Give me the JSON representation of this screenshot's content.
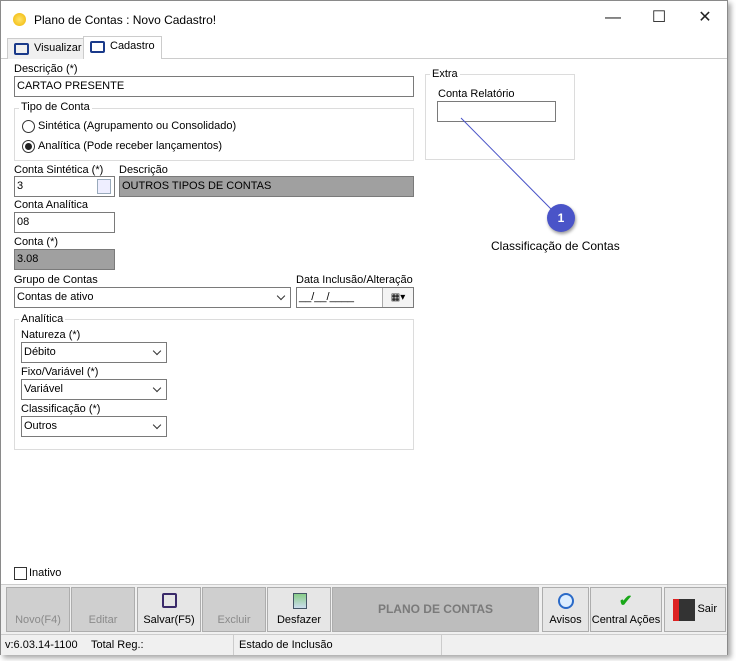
{
  "window": {
    "title": "Plano de Contas  : Novo Cadastro!",
    "minimize": "—",
    "maximize": "☐",
    "close": "✕"
  },
  "tabs": [
    {
      "label": "Visualizar"
    },
    {
      "label": "Cadastro"
    }
  ],
  "form": {
    "descricao_label": "Descrição (*)",
    "descricao_value": "CARTAO PRESENTE",
    "tipo_conta": {
      "label": "Tipo de Conta",
      "options": [
        "Sintética (Agrupamento ou Consolidado)",
        "Analítica (Pode receber lançamentos)"
      ],
      "selected": 1
    },
    "conta_sintetica_label": "Conta Sintética (*)",
    "conta_sintetica_value": "3",
    "descricao2_label": "Descrição",
    "descricao2_value": "OUTROS TIPOS DE CONTAS",
    "conta_analitica_label": "Conta Analítica",
    "conta_analitica_value": "08",
    "conta_label": "Conta (*)",
    "conta_value": "3.08",
    "grupo_label": "Grupo de Contas",
    "grupo_value": "Contas de ativo",
    "data_label": "Data Inclusão/Alteração",
    "data_value": "__/__/____",
    "analitica": {
      "label": "Analítica",
      "natureza_label": "Natureza (*)",
      "natureza_value": "Débito",
      "fixo_label": "Fixo/Variável (*)",
      "fixo_value": "Variável",
      "classificacao_label": "Classificação (*)",
      "classificacao_value": "Outros"
    },
    "extra": {
      "label": "Extra",
      "conta_relatorio_label": "Conta Relatório",
      "conta_relatorio_value": ""
    },
    "inativo_label": "Inativo"
  },
  "callout": {
    "number": "1",
    "text": "Classificação de Contas",
    "color": "#4a54c8"
  },
  "toolbar": {
    "novo": "Novo(F4)",
    "editar": "Editar",
    "salvar": "Salvar(F5)",
    "excluir": "Excluir",
    "desfazer": "Desfazer",
    "panel": "PLANO DE CONTAS",
    "avisos": "Avisos",
    "central": "Central Ações",
    "sair": "Sair"
  },
  "status": {
    "version": "v:6.03.14-1100",
    "total": "Total Reg.:",
    "estado": "Estado de Inclusão"
  }
}
